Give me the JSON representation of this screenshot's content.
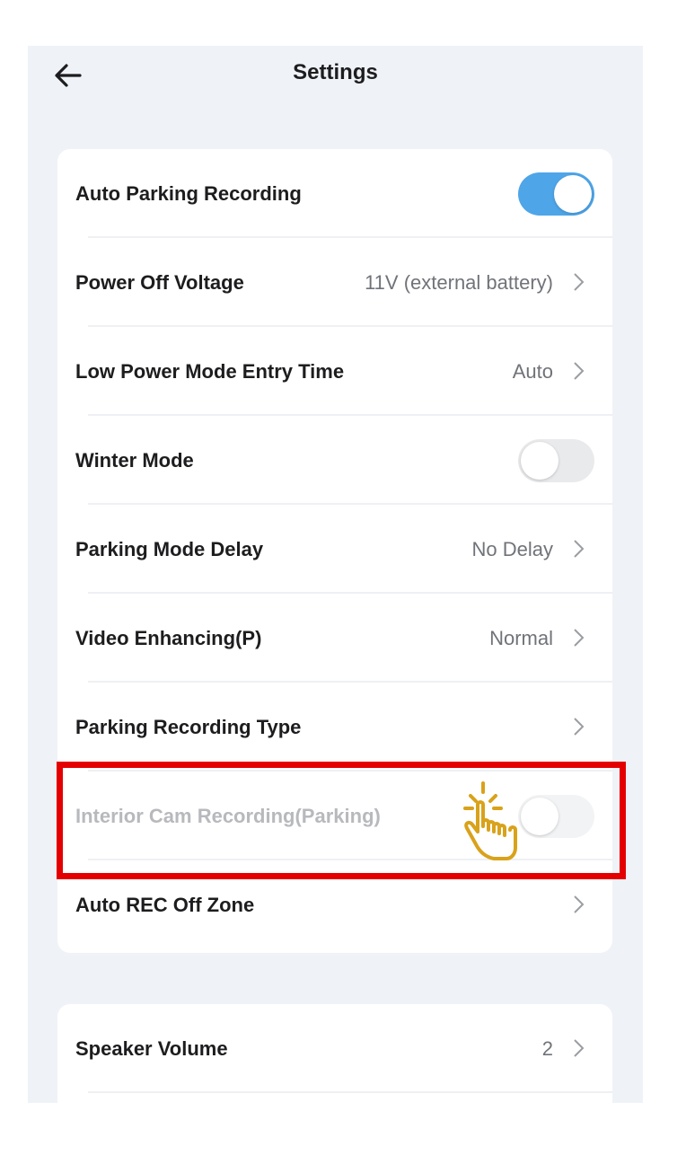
{
  "header": {
    "title": "Settings",
    "back_icon": "arrow-left-icon"
  },
  "colors": {
    "accent": "#4ea5e8",
    "background": "#eff2f6",
    "highlight_border": "#e40000",
    "hand_icon": "#d9a21b",
    "disabled_text": "#b7b9bd"
  },
  "parking_card": {
    "rows": [
      {
        "label": "Auto Parking Recording",
        "control": "toggle",
        "state": "on"
      },
      {
        "label": "Power Off Voltage",
        "value": "11V (external battery)",
        "control": "chevron"
      },
      {
        "label": "Low Power Mode Entry Time",
        "value": "Auto",
        "control": "chevron"
      },
      {
        "label": "Winter Mode",
        "control": "toggle",
        "state": "off"
      },
      {
        "label": "Parking Mode Delay",
        "value": "No Delay",
        "control": "chevron"
      },
      {
        "label": "Video Enhancing(P)",
        "value": "Normal",
        "control": "chevron"
      },
      {
        "label": "Parking Recording Type",
        "control": "chevron"
      },
      {
        "label": "Interior Cam Recording(Parking)",
        "control": "toggle",
        "state": "off",
        "disabled": true,
        "highlighted": true
      },
      {
        "label": "Auto REC Off Zone",
        "control": "chevron"
      }
    ]
  },
  "general_card": {
    "rows": [
      {
        "label": "Speaker Volume",
        "value": "2",
        "control": "chevron"
      }
    ]
  },
  "annotation": {
    "icon": "tap-hand-icon"
  }
}
